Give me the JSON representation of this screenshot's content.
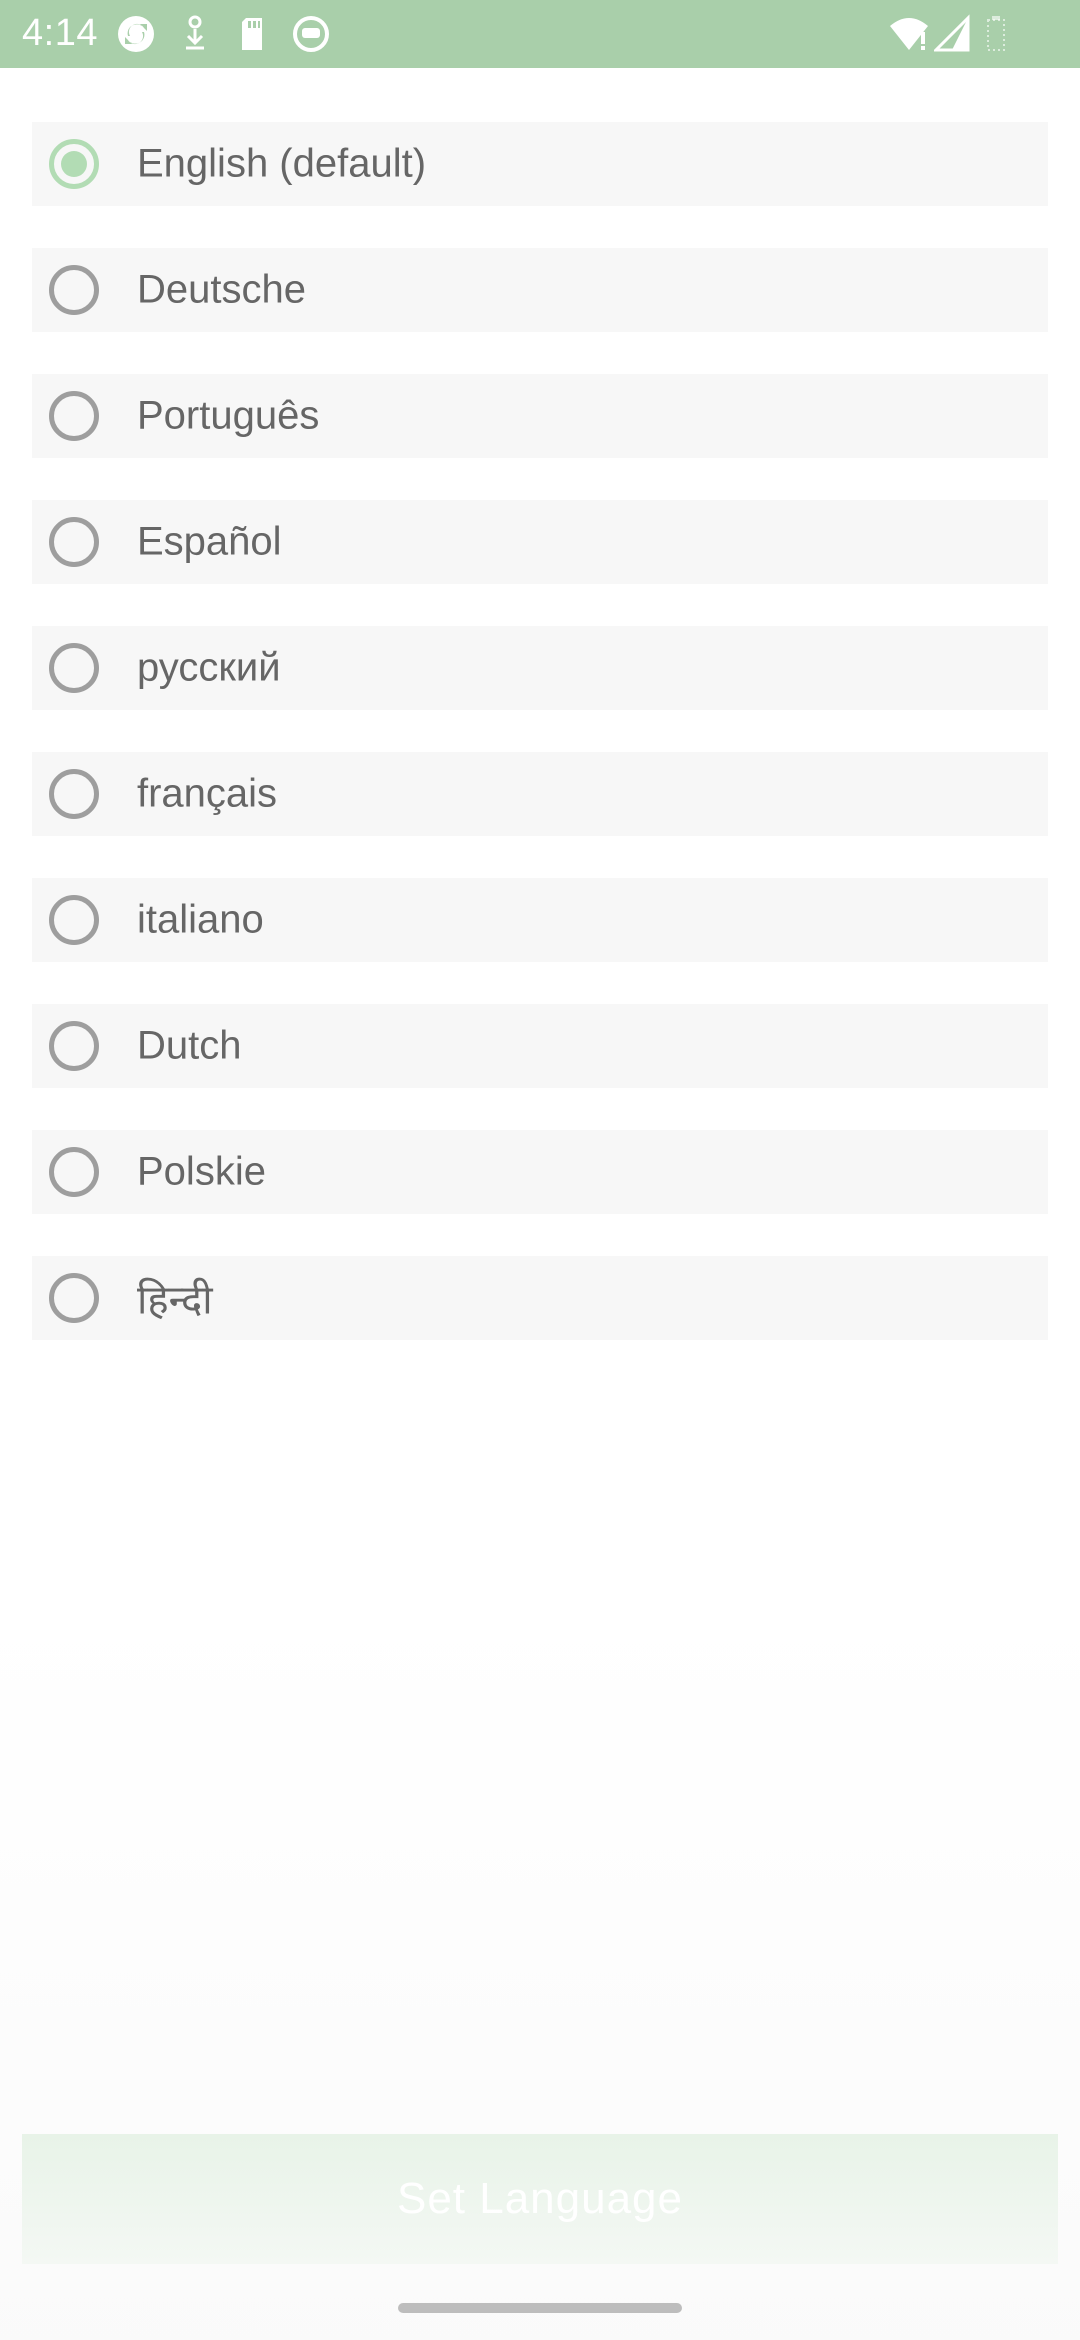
{
  "status_bar": {
    "time": "4:14",
    "color": "#a9cfaa",
    "icons_left": [
      "sync-icon",
      "download-icon",
      "sd-card-icon",
      "app-notification-icon"
    ],
    "icons_right": [
      "wifi-icon",
      "signal-icon",
      "battery-icon"
    ]
  },
  "languages": {
    "selected_index": 0,
    "items": [
      {
        "label": "English (default)",
        "selected": true
      },
      {
        "label": "Deutsche",
        "selected": false
      },
      {
        "label": "Português",
        "selected": false
      },
      {
        "label": "Español",
        "selected": false
      },
      {
        "label": "русский",
        "selected": false
      },
      {
        "label": "français",
        "selected": false
      },
      {
        "label": "italiano",
        "selected": false
      },
      {
        "label": "Dutch",
        "selected": false
      },
      {
        "label": "Polskie",
        "selected": false
      },
      {
        "label": "हिन्दी",
        "selected": false
      }
    ]
  },
  "actions": {
    "set_language_label": "Set Language"
  },
  "colors": {
    "accent": "#b2dcb4",
    "radio_unchecked": "#9e9e9e",
    "item_background": "#f7f7f7",
    "label_text": "#666666"
  }
}
